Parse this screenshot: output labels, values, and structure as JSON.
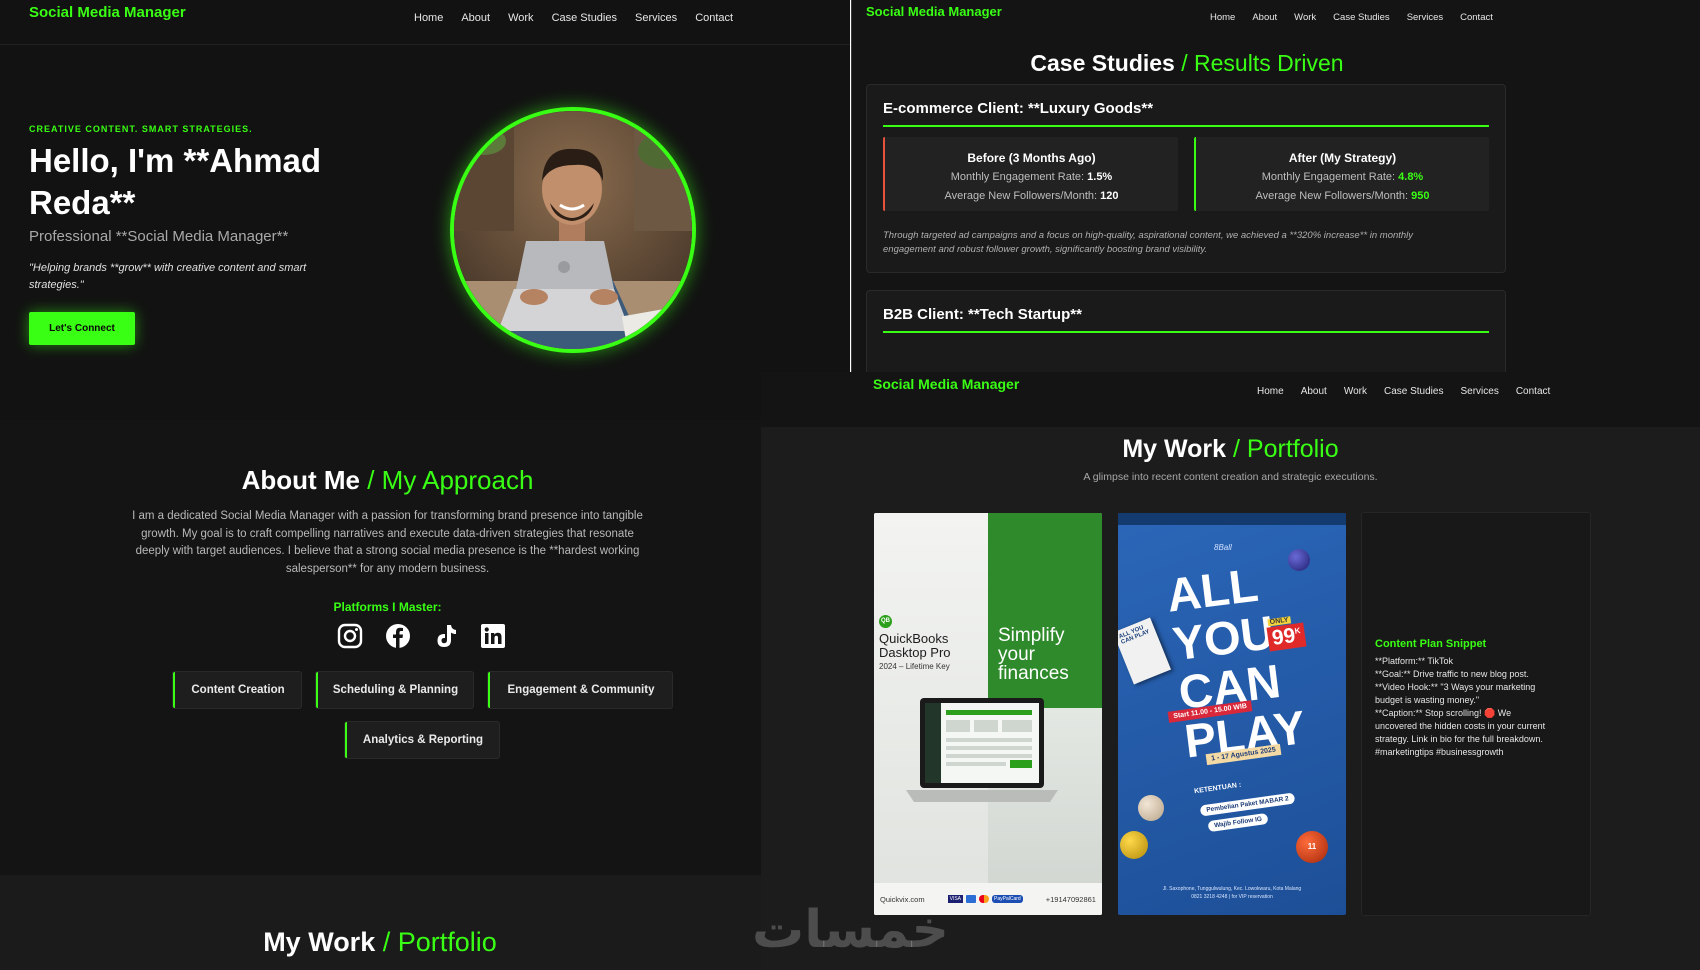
{
  "brand": "Social Media Manager",
  "nav": [
    "Home",
    "About",
    "Work",
    "Case Studies",
    "Services",
    "Contact"
  ],
  "colors": {
    "accent": "#39ff14",
    "bg": "#121212",
    "card": "#1a1a1a"
  },
  "hero": {
    "kicker": "CREATIVE CONTENT. SMART STRATEGIES.",
    "title_line1": "Hello, I'm **Ahmad",
    "title_line2": "Reda**",
    "subtitle": "Professional **Social Media Manager**",
    "quote_line1": "\"Helping brands **grow** with creative content and smart",
    "quote_line2": "strategies.\"",
    "cta": "Let's Connect"
  },
  "case_studies": {
    "title": "Case Studies",
    "title_accent": "/ Results Driven",
    "card1": {
      "heading": "E-commerce Client: **Luxury Goods**",
      "before": {
        "title": "Before (3 Months Ago)",
        "rate_label": "Monthly Engagement Rate:",
        "rate": "1.5%",
        "followers_label": "Average New Followers/Month:",
        "followers": "120"
      },
      "after": {
        "title": "After (My Strategy)",
        "rate_label": "Monthly Engagement Rate:",
        "rate": "4.8%",
        "followers_label": "Average New Followers/Month:",
        "followers": "950"
      },
      "summary_line1": "Through targeted ad campaigns and a focus on high-quality, aspirational content, we achieved a **320% increase** in monthly",
      "summary_line2": "engagement and robust follower growth, significantly boosting brand visibility."
    },
    "card2": {
      "heading": "B2B Client: **Tech Startup**"
    }
  },
  "about": {
    "title": "About Me",
    "title_accent": "/ My Approach",
    "lines": [
      "I am a dedicated Social Media Manager with a passion for transforming brand presence into tangible",
      "growth. My goal is to craft compelling narratives and execute data-driven strategies that resonate",
      "deeply with target audiences. I believe that a strong social media presence is the **hardest working",
      "salesperson** for any modern business."
    ],
    "platforms_label": "Platforms I Master:",
    "platform_icons": [
      "instagram-icon",
      "facebook-icon",
      "tiktok-icon",
      "linkedin-icon"
    ],
    "skills": [
      "Content Creation",
      "Scheduling & Planning",
      "Engagement & Community",
      "Analytics & Reporting"
    ]
  },
  "work_bottom": {
    "title": "My Work",
    "title_accent": "/ Portfolio"
  },
  "portfolio": {
    "title": "My Work",
    "title_accent": "/ Portfolio",
    "subtitle": "A glimpse into recent content creation and strategic executions.",
    "qb": {
      "badge": "QB",
      "product_line1": "QuickBooks",
      "product_line2": "Dasktop Pro",
      "product_line3": "2024 – Lifetime Key",
      "headline_line1": "Simplify",
      "headline_line2": "your",
      "headline_line3": "finances",
      "footer_site": "Quickvix.com",
      "footer_pay": [
        "VISA",
        "",
        "",
        "PayPalCard"
      ],
      "footer_phone": "+19147092861"
    },
    "pool": {
      "logo": "8Ball",
      "headline": [
        "ALL",
        "YOU",
        "CAN",
        "PLAY"
      ],
      "price": "99",
      "price_suffix": "K",
      "price_tag": "ONLY",
      "card_text": "ALL YOU CAN PLAY",
      "time": "Start 11.00 - 15.00 WIB",
      "date": "1 - 17 Agustus 2025",
      "terms_title": "KETENTUAN :",
      "terms": [
        "Pembelian Paket MABAR 2",
        "Wajib Follow IG"
      ],
      "ball_numbers": [
        "",
        "11"
      ],
      "address": "Jl. Saxophone, Tunggulwulung, Kec. Lowokwaru, Kota Malang",
      "phone": "0821 3218 4248 | for VIP reservation"
    },
    "plan": {
      "title": "Content Plan Snippet",
      "lines": [
        "**Platform:** TikTok",
        "**Goal:** Drive traffic to new blog post.",
        "**Video Hook:** \"3 Ways your marketing",
        "budget is wasting money.\"",
        "**Caption:** Stop scrolling! 🛑 We",
        "uncovered the hidden costs in your current",
        "strategy. Link in bio for the full breakdown.",
        "#marketingtips #businessgrowth"
      ]
    }
  },
  "watermark": "خمسات"
}
